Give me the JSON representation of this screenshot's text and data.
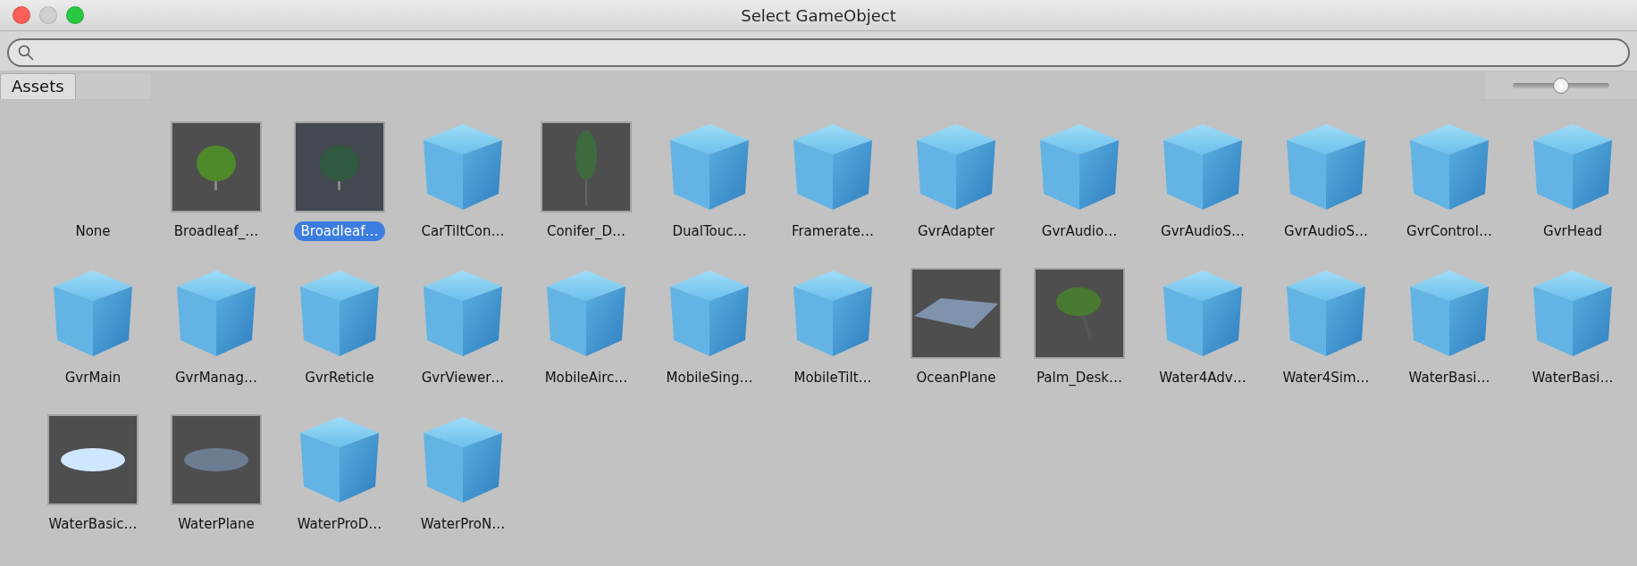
{
  "window": {
    "title": "Select GameObject"
  },
  "tabs": [
    {
      "label": "Assets",
      "selected": true
    }
  ],
  "zoom_slider": {
    "level": 0.5
  },
  "items": [
    {
      "label": "None",
      "kind": "none",
      "selected": false
    },
    {
      "label": "Broadleaf_…",
      "kind": "tree",
      "selected": false
    },
    {
      "label": "Broadleaf…",
      "kind": "tree",
      "selected": true
    },
    {
      "label": "CarTiltCon…",
      "kind": "cube",
      "selected": false
    },
    {
      "label": "Conifer_D…",
      "kind": "conifer",
      "selected": false
    },
    {
      "label": "DualTouc…",
      "kind": "cube",
      "selected": false
    },
    {
      "label": "Framerate…",
      "kind": "cube",
      "selected": false
    },
    {
      "label": "GvrAdapter",
      "kind": "cube",
      "selected": false
    },
    {
      "label": "GvrAudio…",
      "kind": "cube",
      "selected": false
    },
    {
      "label": "GvrAudioS…",
      "kind": "cube",
      "selected": false
    },
    {
      "label": "GvrAudioS…",
      "kind": "cube",
      "selected": false
    },
    {
      "label": "GvrControl…",
      "kind": "cube",
      "selected": false
    },
    {
      "label": "GvrHead",
      "kind": "cube",
      "selected": false
    },
    {
      "label": "GvrMain",
      "kind": "cube",
      "selected": false
    },
    {
      "label": "GvrManag…",
      "kind": "cube",
      "selected": false
    },
    {
      "label": "GvrReticle",
      "kind": "cube",
      "selected": false
    },
    {
      "label": "GvrViewer…",
      "kind": "cube",
      "selected": false
    },
    {
      "label": "MobileAirc…",
      "kind": "cube",
      "selected": false
    },
    {
      "label": "MobileSing…",
      "kind": "cube",
      "selected": false
    },
    {
      "label": "MobileTilt…",
      "kind": "cube",
      "selected": false
    },
    {
      "label": "OceanPlane",
      "kind": "plane",
      "selected": false
    },
    {
      "label": "Palm_Desk…",
      "kind": "palm",
      "selected": false
    },
    {
      "label": "Water4Adv…",
      "kind": "cube",
      "selected": false
    },
    {
      "label": "Water4Sim…",
      "kind": "cube",
      "selected": false
    },
    {
      "label": "WaterBasi…",
      "kind": "cube",
      "selected": false
    },
    {
      "label": "WaterBasi…",
      "kind": "cube",
      "selected": false
    },
    {
      "label": "WaterBasic…",
      "kind": "disc-light",
      "selected": false
    },
    {
      "label": "WaterPlane",
      "kind": "disc-dark",
      "selected": false
    },
    {
      "label": "WaterProD…",
      "kind": "cube",
      "selected": false
    },
    {
      "label": "WaterProN…",
      "kind": "cube",
      "selected": false
    }
  ]
}
